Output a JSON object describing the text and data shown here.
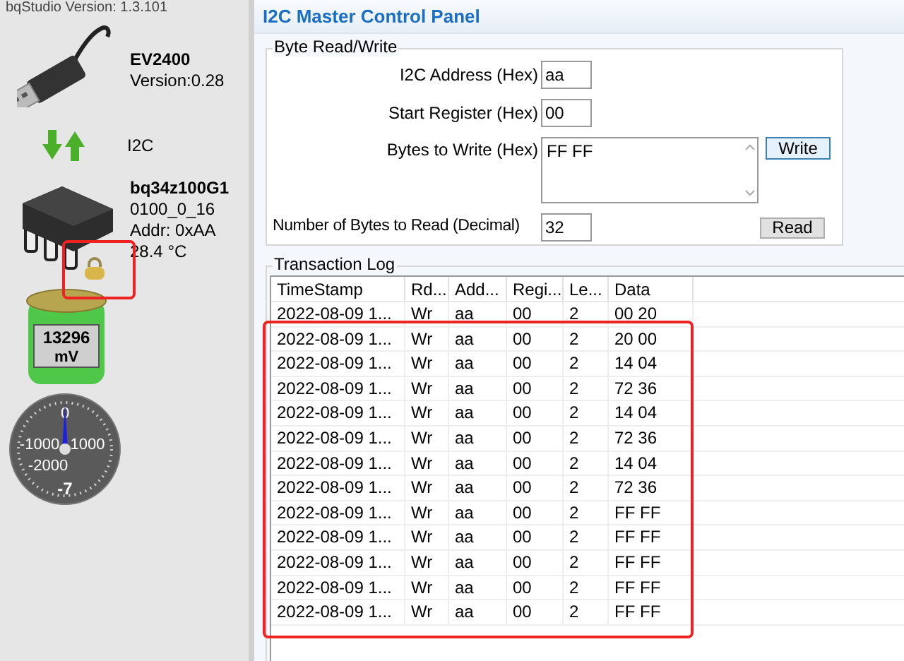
{
  "sidebar": {
    "version_label": "bqStudio Version:  1.3.101",
    "adapter": {
      "name": "EV2400",
      "version": "Version:0.28"
    },
    "bus": {
      "name": "I2C"
    },
    "device": {
      "name": "bq34z100G1",
      "firmware": "0100_0_16",
      "address": "Addr: 0xAA",
      "temperature": "28.4 °C"
    },
    "battery": {
      "voltage": "13296",
      "unit": "mV"
    },
    "gauge": {
      "ticks": [
        "0",
        "-1000",
        "1000",
        "-2000"
      ],
      "reading": "-7"
    }
  },
  "panel": {
    "title": "I2C Master Control Panel",
    "byte_rw": {
      "title": "Byte Read/Write",
      "fields": [
        {
          "label": "I2C Address (Hex)",
          "value": "aa"
        },
        {
          "label": "Start Register (Hex)",
          "value": "00"
        }
      ],
      "write": {
        "label": "Bytes to Write (Hex)",
        "value": "FF FF",
        "button": "Write"
      },
      "read": {
        "label": "Number of Bytes to Read (Decimal)",
        "value": "32",
        "button": "Read"
      }
    },
    "log": {
      "title": "Transaction Log",
      "columns": [
        "TimeStamp",
        "Rd...",
        "Add...",
        "Regi...",
        "Le...",
        "Data"
      ],
      "rows": [
        [
          "2022-08-09 1...",
          "Wr",
          "aa",
          "00",
          "2",
          "00 20"
        ],
        [
          "2022-08-09 1...",
          "Wr",
          "aa",
          "00",
          "2",
          "20 00"
        ],
        [
          "2022-08-09 1...",
          "Wr",
          "aa",
          "00",
          "2",
          "14 04"
        ],
        [
          "2022-08-09 1...",
          "Wr",
          "aa",
          "00",
          "2",
          "72 36"
        ],
        [
          "2022-08-09 1...",
          "Wr",
          "aa",
          "00",
          "2",
          "14 04"
        ],
        [
          "2022-08-09 1...",
          "Wr",
          "aa",
          "00",
          "2",
          "72 36"
        ],
        [
          "2022-08-09 1...",
          "Wr",
          "aa",
          "00",
          "2",
          "14 04"
        ],
        [
          "2022-08-09 1...",
          "Wr",
          "aa",
          "00",
          "2",
          "72 36"
        ],
        [
          "2022-08-09 1...",
          "Wr",
          "aa",
          "00",
          "2",
          "FF FF"
        ],
        [
          "2022-08-09 1...",
          "Wr",
          "aa",
          "00",
          "2",
          "FF FF"
        ],
        [
          "2022-08-09 1...",
          "Wr",
          "aa",
          "00",
          "2",
          "FF FF"
        ],
        [
          "2022-08-09 1...",
          "Wr",
          "aa",
          "00",
          "2",
          "FF FF"
        ],
        [
          "2022-08-09 1...",
          "Wr",
          "aa",
          "00",
          "2",
          "FF FF"
        ]
      ]
    }
  }
}
